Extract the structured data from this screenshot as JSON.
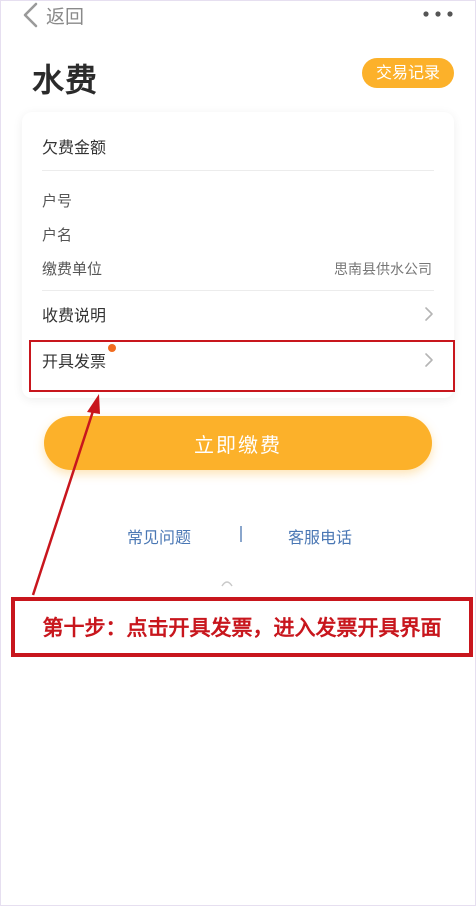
{
  "nav": {
    "back_label": "返回"
  },
  "page": {
    "title": "水费",
    "records_button": "交易记录"
  },
  "card": {
    "amount_label": "欠费金额",
    "info": [
      {
        "label": "户号",
        "value": ""
      },
      {
        "label": "户名",
        "value": ""
      },
      {
        "label": "缴费单位",
        "value": "思南县供水公司"
      }
    ],
    "rows": [
      {
        "label": "收费说明"
      },
      {
        "label": "开具发票"
      }
    ]
  },
  "pay_button": "立即缴费",
  "links": {
    "faq": "常见问题",
    "service": "客服电话"
  },
  "annotation": {
    "text": "第十步：点击开具发票，进入发票开具界面"
  },
  "colors": {
    "accent": "#fcb12a",
    "annotation_red": "#c8161d",
    "link_blue": "#4a77b4",
    "badge_dot": "#f16c20"
  }
}
